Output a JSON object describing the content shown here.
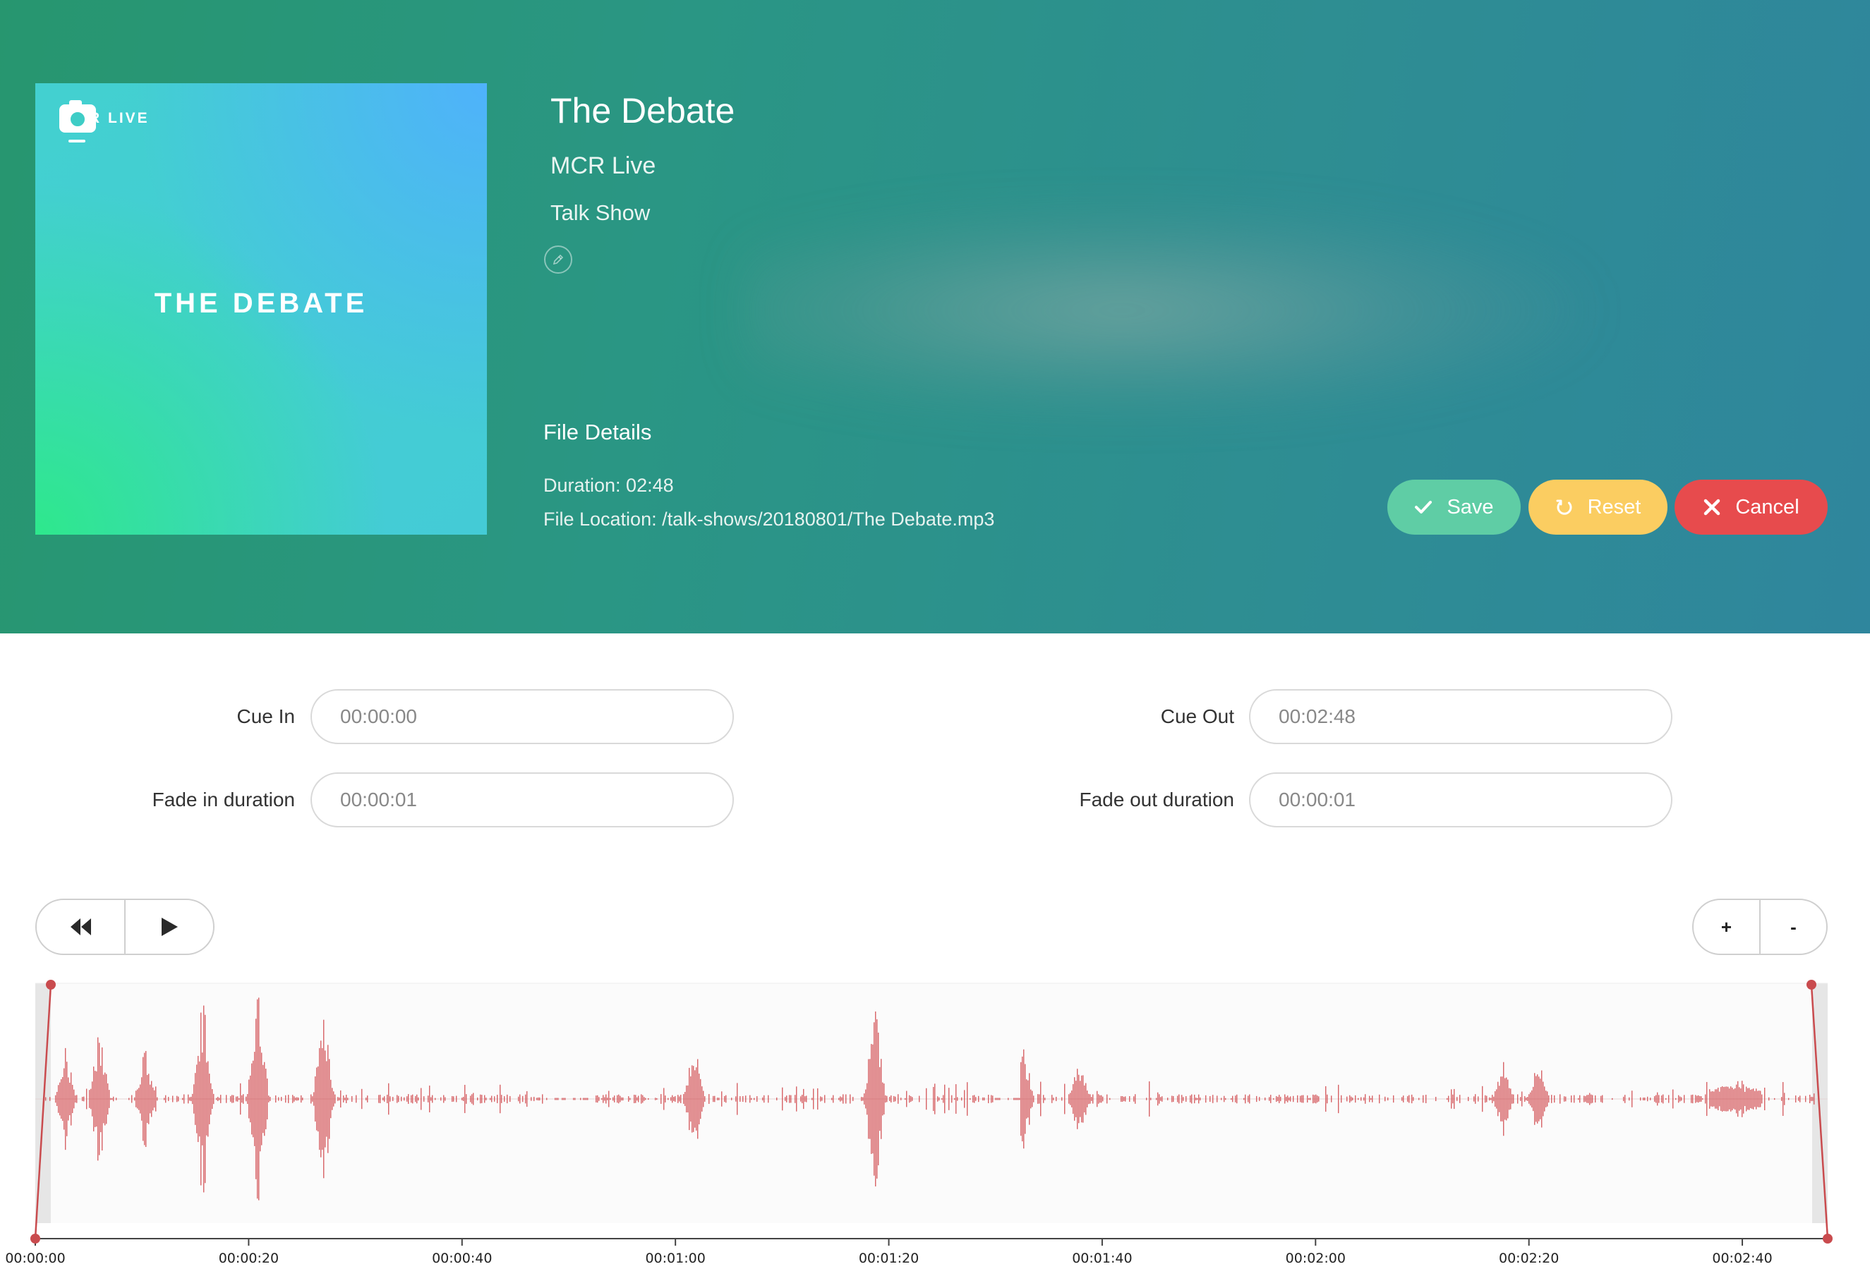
{
  "track": {
    "title": "The Debate",
    "artist": "MCR Live",
    "category": "Talk Show"
  },
  "cover": {
    "title": "THE DEBATE",
    "logo_text": "R LIVE",
    "logo_icon": "camera-logo-icon"
  },
  "file_details": {
    "heading": "File Details",
    "duration": "Duration: 02:48",
    "location": "File Location: /talk-shows/20180801/The Debate.mp3"
  },
  "actions": {
    "save": "Save",
    "reset": "Reset",
    "cancel": "Cancel"
  },
  "form": {
    "cue_in_label": "Cue In",
    "cue_in_value": "00:00:00",
    "cue_out_label": "Cue Out",
    "cue_out_value": "00:02:48",
    "fade_in_label": "Fade in duration",
    "fade_in_value": "00:00:01",
    "fade_out_label": "Fade out duration",
    "fade_out_value": "00:00:01"
  },
  "transport": {
    "rewind_icon": "rewind-icon",
    "play_icon": "play-icon"
  },
  "zoom": {
    "in_label": "+",
    "out_label": "-"
  },
  "timeline": {
    "ticks": [
      "00:00:00",
      "00:00:20",
      "00:00:40",
      "00:01:00",
      "00:01:20",
      "00:01:40",
      "00:02:00",
      "00:02:20",
      "00:02:40"
    ],
    "tick_seconds": [
      0,
      20,
      40,
      60,
      80,
      100,
      120,
      140,
      160
    ],
    "total_seconds": 168
  },
  "colors": {
    "save": "#5fcda5",
    "reset": "#fbcd61",
    "cancel": "#e74b4d",
    "waveform": "#d0474b"
  }
}
